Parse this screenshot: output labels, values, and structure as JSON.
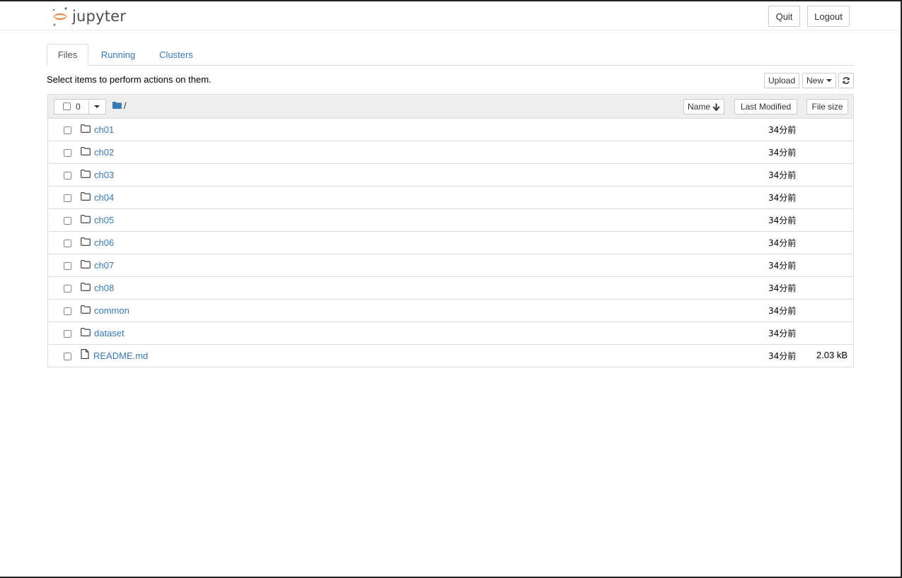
{
  "header": {
    "logo_text": "jupyter",
    "quit_label": "Quit",
    "logout_label": "Logout"
  },
  "tabs": [
    {
      "label": "Files",
      "active": true
    },
    {
      "label": "Running",
      "active": false
    },
    {
      "label": "Clusters",
      "active": false
    }
  ],
  "toolbar": {
    "hint": "Select items to perform actions on them.",
    "upload_label": "Upload",
    "new_label": "New"
  },
  "list_header": {
    "selected_count": "0",
    "path": "/",
    "name_label": "Name",
    "last_modified_label": "Last Modified",
    "file_size_label": "File size"
  },
  "items": [
    {
      "name": "ch01",
      "type": "folder",
      "modified": "34分前",
      "size": ""
    },
    {
      "name": "ch02",
      "type": "folder",
      "modified": "34分前",
      "size": ""
    },
    {
      "name": "ch03",
      "type": "folder",
      "modified": "34分前",
      "size": ""
    },
    {
      "name": "ch04",
      "type": "folder",
      "modified": "34分前",
      "size": ""
    },
    {
      "name": "ch05",
      "type": "folder",
      "modified": "34分前",
      "size": ""
    },
    {
      "name": "ch06",
      "type": "folder",
      "modified": "34分前",
      "size": ""
    },
    {
      "name": "ch07",
      "type": "folder",
      "modified": "34分前",
      "size": ""
    },
    {
      "name": "ch08",
      "type": "folder",
      "modified": "34分前",
      "size": ""
    },
    {
      "name": "common",
      "type": "folder",
      "modified": "34分前",
      "size": ""
    },
    {
      "name": "dataset",
      "type": "folder",
      "modified": "34分前",
      "size": ""
    },
    {
      "name": "README.md",
      "type": "file",
      "modified": "34分前",
      "size": "2.03 kB"
    }
  ],
  "colors": {
    "link": "#337ab7",
    "logo_orange": "#f37726",
    "logo_gray": "#767677"
  }
}
